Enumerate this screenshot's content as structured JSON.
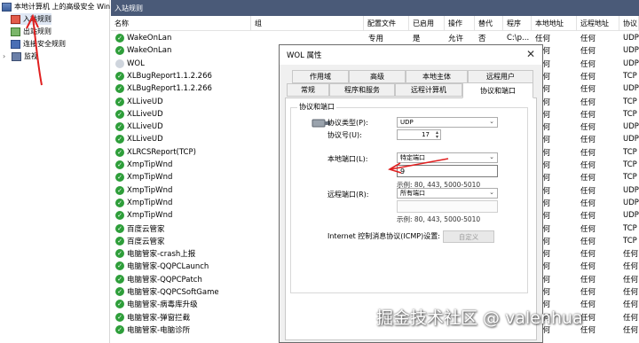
{
  "tree": {
    "root": "本地计算机 上的高级安全 Win",
    "items": [
      {
        "label": "入站规则"
      },
      {
        "label": "出站规则"
      },
      {
        "label": "连接安全规则"
      },
      {
        "label": "监视"
      }
    ]
  },
  "header": {
    "title": "入站规则"
  },
  "table": {
    "columns": [
      "名称",
      "组",
      "配置文件",
      "已启用",
      "操作",
      "替代",
      "程序",
      "本地地址",
      "远程地址",
      "协议"
    ],
    "rows": [
      {
        "name": "WakeOnLan",
        "profile": "专用",
        "enabled": "是",
        "action": "允许",
        "override": "否",
        "program": "C:\\p...",
        "local": "任何",
        "remote": "任何",
        "protocol": "UDP",
        "status": "green"
      },
      {
        "name": "WakeOnLan",
        "profile": "",
        "enabled": "",
        "action": "",
        "override": "",
        "program": "",
        "local": "任何",
        "remote": "任何",
        "protocol": "UDP",
        "status": "green"
      },
      {
        "name": "WOL",
        "profile": "",
        "enabled": "",
        "action": "",
        "override": "",
        "program": "",
        "local": "任何",
        "remote": "任何",
        "protocol": "UDP",
        "status": "grey"
      },
      {
        "name": "XLBugReport1.1.2.266",
        "profile": "",
        "enabled": "",
        "action": "",
        "override": "",
        "program": "",
        "local": "任何",
        "remote": "任何",
        "protocol": "TCP",
        "status": "green"
      },
      {
        "name": "XLBugReport1.1.2.266",
        "profile": "",
        "enabled": "",
        "action": "",
        "override": "",
        "program": "",
        "local": "任何",
        "remote": "任何",
        "protocol": "UDP",
        "status": "green"
      },
      {
        "name": "XLLiveUD",
        "profile": "",
        "enabled": "",
        "action": "",
        "override": "",
        "program": "",
        "local": "任何",
        "remote": "任何",
        "protocol": "TCP",
        "status": "green"
      },
      {
        "name": "XLLiveUD",
        "profile": "",
        "enabled": "",
        "action": "",
        "override": "",
        "program": "",
        "local": "任何",
        "remote": "任何",
        "protocol": "TCP",
        "status": "green"
      },
      {
        "name": "XLLiveUD",
        "profile": "",
        "enabled": "",
        "action": "",
        "override": "",
        "program": "",
        "local": "任何",
        "remote": "任何",
        "protocol": "UDP",
        "status": "green"
      },
      {
        "name": "XLLiveUD",
        "profile": "",
        "enabled": "",
        "action": "",
        "override": "",
        "program": "",
        "local": "任何",
        "remote": "任何",
        "protocol": "UDP",
        "status": "green"
      },
      {
        "name": "XLRCSReport(TCP)",
        "profile": "",
        "enabled": "",
        "action": "",
        "override": "",
        "program": "",
        "local": "任何",
        "remote": "任何",
        "protocol": "TCP",
        "status": "green"
      },
      {
        "name": "XmpTipWnd",
        "profile": "",
        "enabled": "",
        "action": "",
        "override": "",
        "program": "",
        "local": "任何",
        "remote": "任何",
        "protocol": "TCP",
        "status": "green"
      },
      {
        "name": "XmpTipWnd",
        "profile": "",
        "enabled": "",
        "action": "",
        "override": "",
        "program": "",
        "local": "任何",
        "remote": "任何",
        "protocol": "TCP",
        "status": "green"
      },
      {
        "name": "XmpTipWnd",
        "profile": "",
        "enabled": "",
        "action": "",
        "override": "",
        "program": "",
        "local": "任何",
        "remote": "任何",
        "protocol": "UDP",
        "status": "green"
      },
      {
        "name": "XmpTipWnd",
        "profile": "",
        "enabled": "",
        "action": "",
        "override": "",
        "program": "",
        "local": "任何",
        "remote": "任何",
        "protocol": "UDP",
        "status": "green"
      },
      {
        "name": "XmpTipWnd",
        "profile": "",
        "enabled": "",
        "action": "",
        "override": "",
        "program": "",
        "local": "任何",
        "remote": "任何",
        "protocol": "UDP",
        "status": "green"
      },
      {
        "name": "百度云管家",
        "profile": "",
        "enabled": "",
        "action": "",
        "override": "",
        "program": "",
        "local": "任何",
        "remote": "任何",
        "protocol": "TCP",
        "status": "green"
      },
      {
        "name": "百度云管家",
        "profile": "",
        "enabled": "",
        "action": "",
        "override": "",
        "program": "",
        "local": "任何",
        "remote": "任何",
        "protocol": "TCP",
        "status": "green"
      },
      {
        "name": "电脑管家-crash上报",
        "profile": "",
        "enabled": "",
        "action": "",
        "override": "",
        "program": "",
        "local": "任何",
        "remote": "任何",
        "protocol": "任何",
        "status": "green"
      },
      {
        "name": "电脑管家-QQPCLaunch",
        "profile": "",
        "enabled": "",
        "action": "",
        "override": "",
        "program": "",
        "local": "任何",
        "remote": "任何",
        "protocol": "任何",
        "status": "green"
      },
      {
        "name": "电脑管家-QQPCPatch",
        "profile": "",
        "enabled": "",
        "action": "",
        "override": "",
        "program": "",
        "local": "任何",
        "remote": "任何",
        "protocol": "任何",
        "status": "green"
      },
      {
        "name": "电脑管家-QQPCSoftGame",
        "profile": "",
        "enabled": "",
        "action": "",
        "override": "",
        "program": "",
        "local": "任何",
        "remote": "任何",
        "protocol": "任何",
        "status": "green"
      },
      {
        "name": "电脑管家-病毒库升级",
        "profile": "",
        "enabled": "",
        "action": "",
        "override": "",
        "program": "",
        "local": "任何",
        "remote": "任何",
        "protocol": "任何",
        "status": "green"
      },
      {
        "name": "电脑管家-弹窗拦截",
        "profile": "",
        "enabled": "",
        "action": "",
        "override": "",
        "program": "",
        "local": "任何",
        "remote": "任何",
        "protocol": "任何",
        "status": "green"
      },
      {
        "name": "电脑管家-电脑诊所",
        "profile": "",
        "enabled": "",
        "action": "",
        "override": "",
        "program": "",
        "local": "任何",
        "remote": "任何",
        "protocol": "任何",
        "status": "green"
      }
    ]
  },
  "dialog": {
    "title": "WOL 属性",
    "close": "✕",
    "tabs_row1": [
      "作用域",
      "高级",
      "本地主体",
      "远程用户"
    ],
    "tabs_row2": [
      "常规",
      "程序和服务",
      "远程计算机",
      "协议和端口"
    ],
    "group_title": "协议和端口",
    "protocol_type_label": "协议类型(P):",
    "protocol_type_value": "UDP",
    "protocol_number_label": "协议号(U):",
    "protocol_number_value": "17",
    "local_port_label": "本地端口(L):",
    "local_port_value": "特定端口",
    "local_port_input": "9",
    "local_example": "示例: 80, 443, 5000-5010",
    "remote_port_label": "远程端口(R):",
    "remote_port_value": "所有端口",
    "remote_port_input": "",
    "remote_example": "示例: 80, 443, 5000-5010",
    "icmp_label": "Internet 控制消息协议(ICMP)设置:",
    "custom_button": "自定义"
  },
  "watermark": "掘金技术社区 @ valenhua",
  "colors": {
    "header_bg": "#4a5a78",
    "status_green": "#2e9e3a",
    "annotation_red": "#e02020"
  }
}
